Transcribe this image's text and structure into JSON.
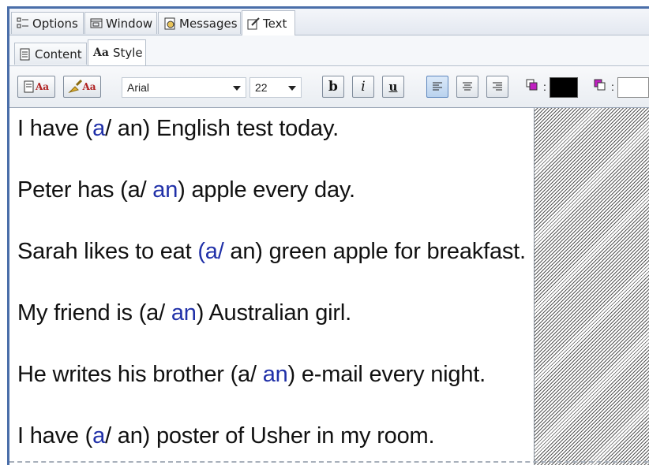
{
  "tabs": [
    {
      "label": "Options",
      "icon": "options-icon"
    },
    {
      "label": "Window",
      "icon": "window-icon"
    },
    {
      "label": "Messages",
      "icon": "messages-icon"
    },
    {
      "label": "Text",
      "icon": "edit-text-icon",
      "active": true
    }
  ],
  "subtabs": [
    {
      "label": "Content",
      "icon": "document-icon"
    },
    {
      "label": "Style",
      "icon_text": "Aa",
      "active": true
    }
  ],
  "toolbar": {
    "font_family": "Arial",
    "font_size": "22",
    "bold_label": "b",
    "italic_label": "i",
    "underline_label": "u",
    "style_button_text": "Aa",
    "clear_style_button_text": "Aa",
    "text_color_label": ":",
    "background_color_label": ":",
    "text_color_value": "#000000",
    "background_color_value": "#ffffff",
    "alignment": "left"
  },
  "sentences": [
    {
      "pre": "I have (",
      "opt1": "a",
      "mid": "/ an) English test today.",
      "opt2": "",
      "post": "",
      "selected": "a"
    },
    {
      "pre": "Peter has (a/ ",
      "opt1": "",
      "mid": "",
      "opt2": "an",
      "post": ") apple every day.",
      "selected": "an"
    },
    {
      "pre": "Sarah likes to eat ",
      "opt1": "(a/",
      "mid": " an) green apple for breakfast.",
      "opt2": "",
      "post": "",
      "selected": "a"
    },
    {
      "pre": "My friend is (a/ ",
      "opt1": "",
      "mid": "",
      "opt2": "an",
      "post": ") Australian girl.",
      "selected": "an"
    },
    {
      "pre": "He writes his brother (a/ ",
      "opt1": "",
      "mid": "",
      "opt2": "an",
      "post": ") e-mail every night.",
      "selected": "an"
    },
    {
      "pre": "I have (",
      "opt1": "a",
      "mid": "/ an) poster of Usher in my room.",
      "opt2": "",
      "post": "",
      "selected": "a"
    }
  ],
  "colors": {
    "answer_highlight": "#2030a8",
    "frame_accent": "#4a6ea9"
  }
}
